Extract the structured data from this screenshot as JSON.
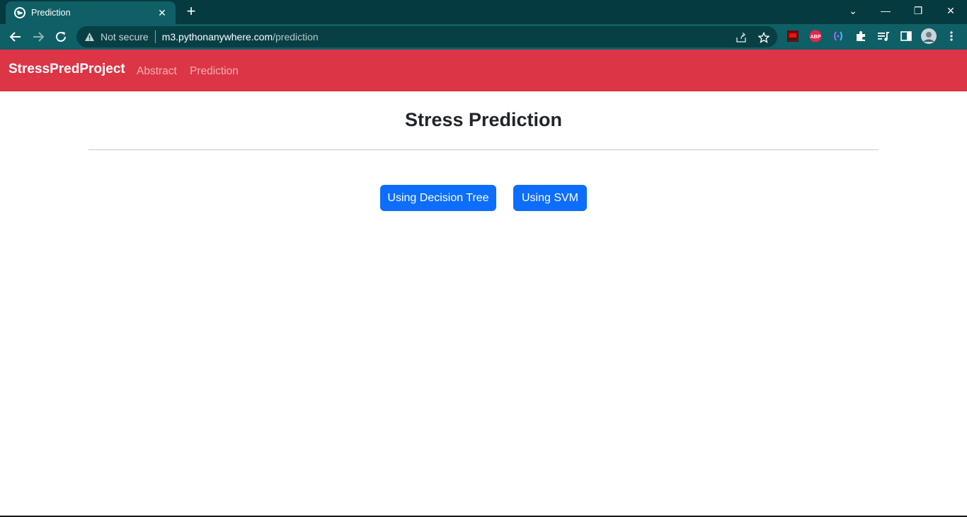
{
  "browser": {
    "tab_title": "Prediction",
    "tab_close": "✕",
    "new_tab": "+",
    "security_text": "Not secure",
    "url_host": "m3.pythonanywhere.com",
    "url_path": "/prediction",
    "window_controls": {
      "tab_search": "⌄",
      "minimize": "—",
      "restore": "❐",
      "close": "✕"
    },
    "icons": [
      "globe-icon",
      "back-arrow-icon",
      "forward-arrow-icon",
      "reload-icon",
      "warning-icon",
      "share-icon",
      "star-icon",
      "puzzle-icon",
      "media-icon",
      "side-panel-icon",
      "profile-avatar",
      "menu-dots-icon"
    ],
    "extensions": {
      "abp_label": "ABP"
    }
  },
  "navbar": {
    "brand": "StressPredProject",
    "links": [
      "Abstract",
      "Prediction"
    ],
    "color": "#dc3545"
  },
  "main": {
    "title": "Stress Prediction",
    "buttons": [
      "Using Decision Tree",
      "Using SVM"
    ],
    "button_color": "#0d6efd"
  }
}
